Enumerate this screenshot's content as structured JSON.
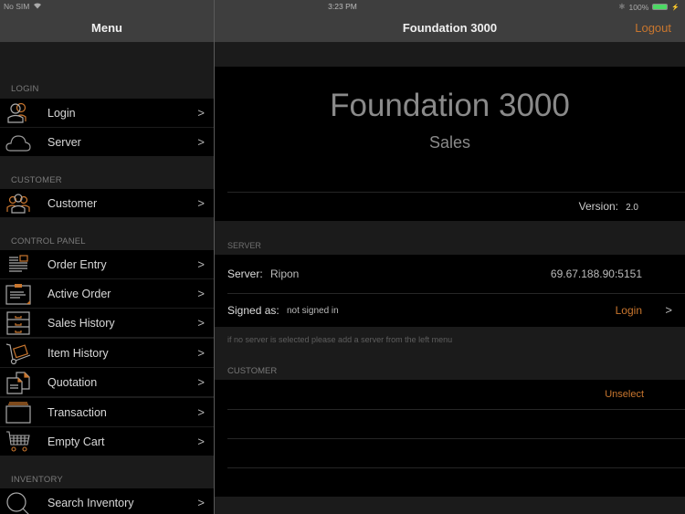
{
  "status_bar": {
    "carrier": "No SIM",
    "time": "3:23 PM",
    "battery": "100%"
  },
  "sidebar": {
    "title": "Menu",
    "sections": [
      {
        "header": "LOGIN",
        "items": [
          {
            "label": "Login",
            "icon": "users-icon"
          },
          {
            "label": "Server",
            "icon": "cloud-icon"
          }
        ]
      },
      {
        "header": "CUSTOMER",
        "items": [
          {
            "label": "Customer",
            "icon": "customer-group-icon"
          }
        ]
      },
      {
        "header": "CONTROL PANEL",
        "items": [
          {
            "label": "Order Entry",
            "icon": "order-entry-icon"
          },
          {
            "label": "Active Order",
            "icon": "clipboard-icon"
          },
          {
            "label": "Sales History",
            "icon": "drawers-icon"
          },
          {
            "label": "Item History",
            "icon": "hand-truck-icon"
          },
          {
            "label": "Quotation",
            "icon": "documents-icon"
          },
          {
            "label": "Transaction",
            "icon": "tray-icon"
          },
          {
            "label": "Empty Cart",
            "icon": "cart-icon"
          }
        ]
      },
      {
        "header": "INVENTORY",
        "items": [
          {
            "label": "Search Inventory",
            "icon": "search-icon"
          }
        ]
      }
    ]
  },
  "main": {
    "title": "Foundation 3000",
    "logout_label": "Logout",
    "hero": {
      "title": "Foundation 3000",
      "subtitle": "Sales"
    },
    "version": {
      "label": "Version:",
      "value": "2.0"
    },
    "server_section": {
      "header": "SERVER",
      "server_label": "Server:",
      "server_name": "Ripon",
      "server_address": "69.67.188.90:5151",
      "signed_label": "Signed as:",
      "signed_value": "not signed in",
      "login_label": "Login",
      "note": "if no server is selected please add a server from the left menu"
    },
    "customer_section": {
      "header": "CUSTOMER",
      "unselect_label": "Unselect"
    }
  },
  "colors": {
    "accent": "#c9762e",
    "navbar": "#3e3e3e",
    "background": "#1b1b1b",
    "cell": "#000000"
  }
}
